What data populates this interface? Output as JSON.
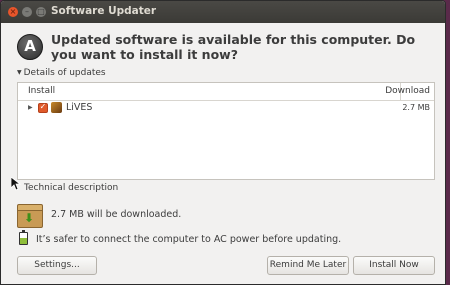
{
  "window": {
    "title": "Software Updater"
  },
  "window_controls": {
    "close": "×",
    "minimize": "–",
    "maximize": "□"
  },
  "app_icon_glyph": "A",
  "headline": "Updated software is available for this computer. Do you want to install it now?",
  "details": {
    "toggle_label": "Details of updates",
    "columns": {
      "install": "Install",
      "download": "Download"
    },
    "rows": [
      {
        "name": "LiVES",
        "size": "2.7 MB",
        "checked": true
      }
    ]
  },
  "technical_description_label": "Technical description",
  "download_info": "2.7 MB will be downloaded.",
  "power_info": "It’s safer to connect the computer to AC power before updating.",
  "buttons": {
    "settings": "Settings...",
    "remind": "Remind Me Later",
    "install": "Install Now"
  },
  "colors": {
    "close_button": "#e8552b",
    "checkbox": "#e05a2a",
    "titlebar": "#3b3a36"
  }
}
